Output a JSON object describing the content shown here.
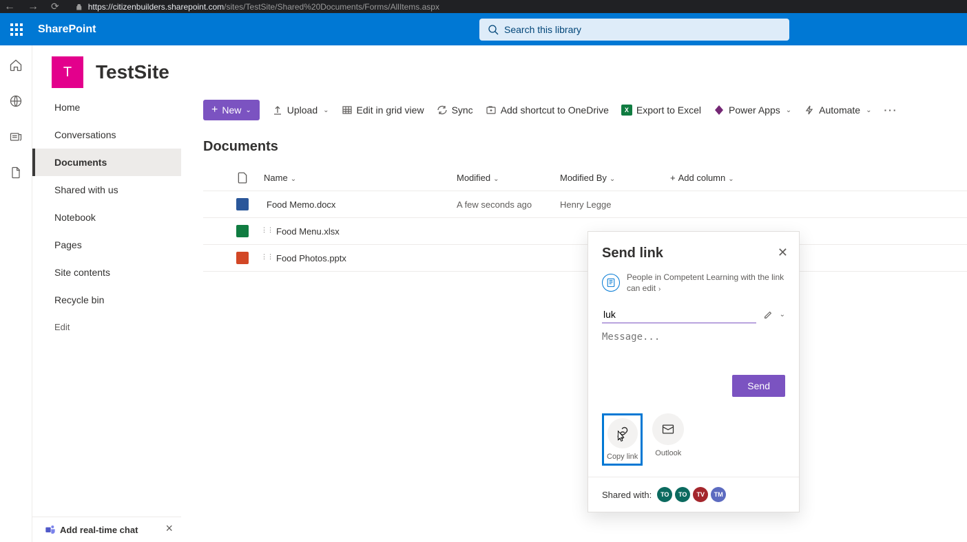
{
  "browser": {
    "url_bold": "https://citizenbuilders.sharepoint.com",
    "url_path": "/sites/TestSite/Shared%20Documents/Forms/AllItems.aspx"
  },
  "suite": {
    "app_name": "SharePoint",
    "search_placeholder": "Search this library"
  },
  "site": {
    "logo_letter": "T",
    "title": "TestSite"
  },
  "leftnav": {
    "items": [
      {
        "label": "Home"
      },
      {
        "label": "Conversations"
      },
      {
        "label": "Documents",
        "selected": true
      },
      {
        "label": "Shared with us"
      },
      {
        "label": "Notebook"
      },
      {
        "label": "Pages"
      },
      {
        "label": "Site contents"
      },
      {
        "label": "Recycle bin"
      }
    ],
    "edit": "Edit",
    "chat_promo": "Add real-time chat"
  },
  "cmdbar": {
    "new": "New",
    "upload": "Upload",
    "editgrid": "Edit in grid view",
    "sync": "Sync",
    "shortcut": "Add shortcut to OneDrive",
    "export": "Export to Excel",
    "powerapps": "Power Apps",
    "automate": "Automate"
  },
  "library": {
    "title": "Documents",
    "cols": {
      "name": "Name",
      "modified": "Modified",
      "modifiedby": "Modified By",
      "addcol": "Add column"
    },
    "rows": [
      {
        "name": "Food Memo.docx",
        "modified": "A few seconds ago",
        "by": "Henry Legge",
        "new": false,
        "type": "doc"
      },
      {
        "name": "Food Menu.xlsx",
        "modified": "",
        "by": "",
        "new": true,
        "type": "xls"
      },
      {
        "name": "Food Photos.pptx",
        "modified": "",
        "by": "",
        "new": true,
        "type": "ppt"
      }
    ]
  },
  "modal": {
    "title": "Send link",
    "perm_text": "People in Competent Learning with the link can edit",
    "name_value": "luk",
    "msg_placeholder": "Message...",
    "send": "Send",
    "copylink": "Copy link",
    "outlook": "Outlook",
    "sharedwith": "Shared with:",
    "avatars": [
      "TO",
      "TO",
      "TV",
      "TM"
    ]
  }
}
